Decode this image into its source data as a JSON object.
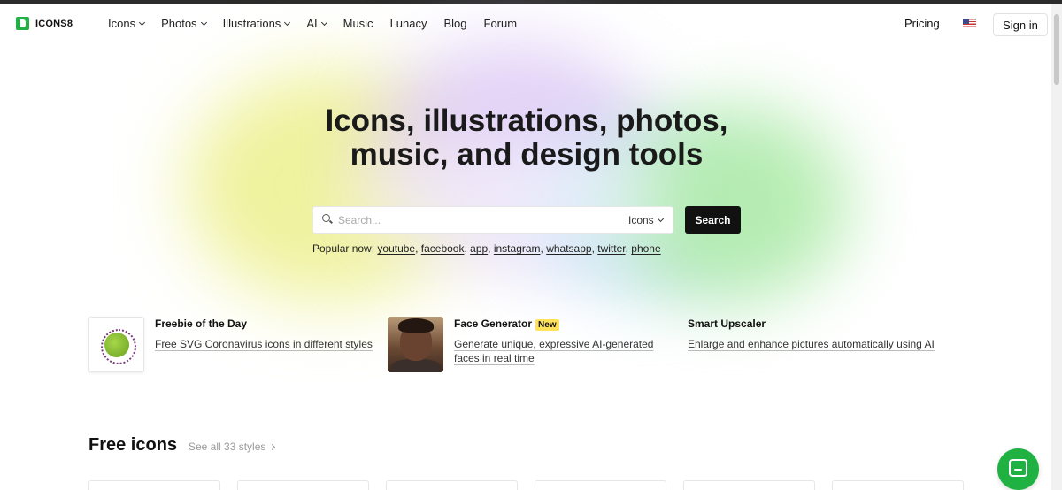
{
  "brand": {
    "name": "ICONS8",
    "accent": "#1fb141"
  },
  "nav": {
    "items": [
      {
        "label": "Icons",
        "dropdown": true
      },
      {
        "label": "Photos",
        "dropdown": true
      },
      {
        "label": "Illustrations",
        "dropdown": true
      },
      {
        "label": "AI",
        "dropdown": true
      },
      {
        "label": "Music",
        "dropdown": false
      },
      {
        "label": "Lunacy",
        "dropdown": false
      },
      {
        "label": "Blog",
        "dropdown": false
      },
      {
        "label": "Forum",
        "dropdown": false
      }
    ],
    "pricing": "Pricing",
    "flag_icon": "us-flag-icon",
    "signin": "Sign in"
  },
  "hero": {
    "title_line1": "Icons, illustrations, photos,",
    "title_line2": "music, and design tools",
    "search": {
      "placeholder": "Search...",
      "value": "",
      "type": "Icons",
      "button": "Search"
    },
    "popular_label": "Popular now:",
    "popular": [
      "youtube",
      "facebook",
      "app",
      "instagram",
      "whatsapp",
      "twitter",
      "phone"
    ]
  },
  "features": [
    {
      "title": "Freebie of the Day",
      "badge": "",
      "desc": "Free SVG Coronavirus icons in different styles",
      "icon": "coronavirus-icon"
    },
    {
      "title": "Face Generator",
      "badge": "New",
      "desc_line1": "Generate unique, expressive AI-generated",
      "desc_line2": "faces in real time",
      "icon": "face-photo"
    },
    {
      "title": "Smart Upscaler",
      "badge": "",
      "desc": "Enlarge and enhance pictures automatically using AI"
    }
  ],
  "free_icons": {
    "title": "Free icons",
    "see_all": "See all 33 styles"
  },
  "chat": {
    "icon": "chat-icon"
  }
}
